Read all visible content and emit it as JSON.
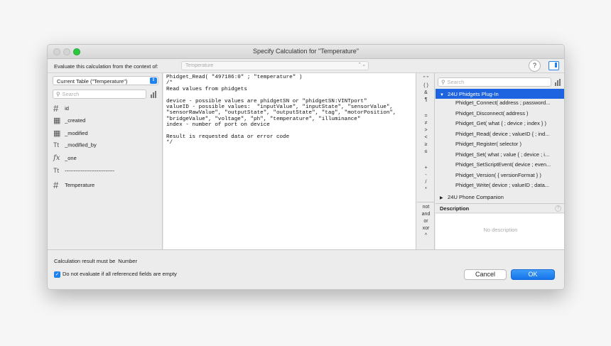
{
  "window": {
    "title": "Specify Calculation for \"Temperature\""
  },
  "context": {
    "label": "Evaluate this calculation from the context of:",
    "value": "Temperature",
    "help_label": "?"
  },
  "fields_pane": {
    "table_select": "Current Table (\"Temperature\")",
    "search_placeholder": "Search",
    "fields": [
      {
        "icon": "number-icon",
        "glyph": "#",
        "label": "id"
      },
      {
        "icon": "date-icon",
        "glyph": "▦",
        "label": "_created"
      },
      {
        "icon": "date-icon",
        "glyph": "▦",
        "label": "_modified"
      },
      {
        "icon": "text-icon",
        "glyph": "Tt",
        "label": "_modified_by"
      },
      {
        "icon": "function-icon",
        "glyph": "fx",
        "label": "_one"
      },
      {
        "icon": "text-icon",
        "glyph": "Tt",
        "label": "----------------------------"
      },
      {
        "icon": "number-icon",
        "glyph": "#",
        "label": "Temperature"
      }
    ]
  },
  "editor": {
    "code": "Phidget_Read( \"497186:0\" ; \"temperature\" )\n/*\nRead values from phidgets\n\ndevice - possible values are phidgetSN or \"phidgetSN:VINTport\"\nvalueID - possible values:  \"inputValue\", \"inputState\", \"sensorValue\",\n\"sensorRawValue\", \"outputState\", \"outputState\", \"tag\", \"motorPosition\",\n\"bridgeValue\", \"voltage\", \"ph\", \"temperature\", \"illuminance\"\nindex - number of port on device\n\nResult is requested data or error code\n*/"
  },
  "operators": {
    "group1": [
      "\" \"",
      "( )",
      "&",
      "¶"
    ],
    "group2": [
      "=",
      "≠",
      ">",
      "<",
      "≥",
      "≤"
    ],
    "group3": [
      "+",
      "-",
      "/",
      "*"
    ],
    "group4": [
      "not",
      "and",
      "or",
      "xor",
      "^"
    ]
  },
  "functions_pane": {
    "search_placeholder": "Search",
    "groups": [
      {
        "label": "24U Phidgets Plug-In",
        "expanded": true
      },
      {
        "label": "24U Phone Companion",
        "expanded": false
      }
    ],
    "items": [
      "Phidget_Connect( address ; password...",
      "Phidget_Disconnect( address )",
      "Phidget_Get( what { ; device ; index } )",
      "Phidget_Read( device ; valueID { ; ind...",
      "Phidget_Register( selector )",
      "Phidget_Set( what ; value { ; device ; i...",
      "Phidget_SetScriptEvent( device ; even...",
      "Phidget_Version( { versionFormat } )",
      "Phidget_Write( device ; valueID ; data..."
    ],
    "description_title": "Description",
    "description_help": "?",
    "description_body": "No description"
  },
  "footer": {
    "result_label": "Calculation result must be",
    "result_type": "Number",
    "checkbox_label": "Do not evaluate if all referenced fields are empty",
    "checkbox_checked": true,
    "cancel_label": "Cancel",
    "ok_label": "OK"
  },
  "colors": {
    "accent": "#1e82f0",
    "selection": "#1e64e0",
    "zoom_button": "#2bc840"
  }
}
